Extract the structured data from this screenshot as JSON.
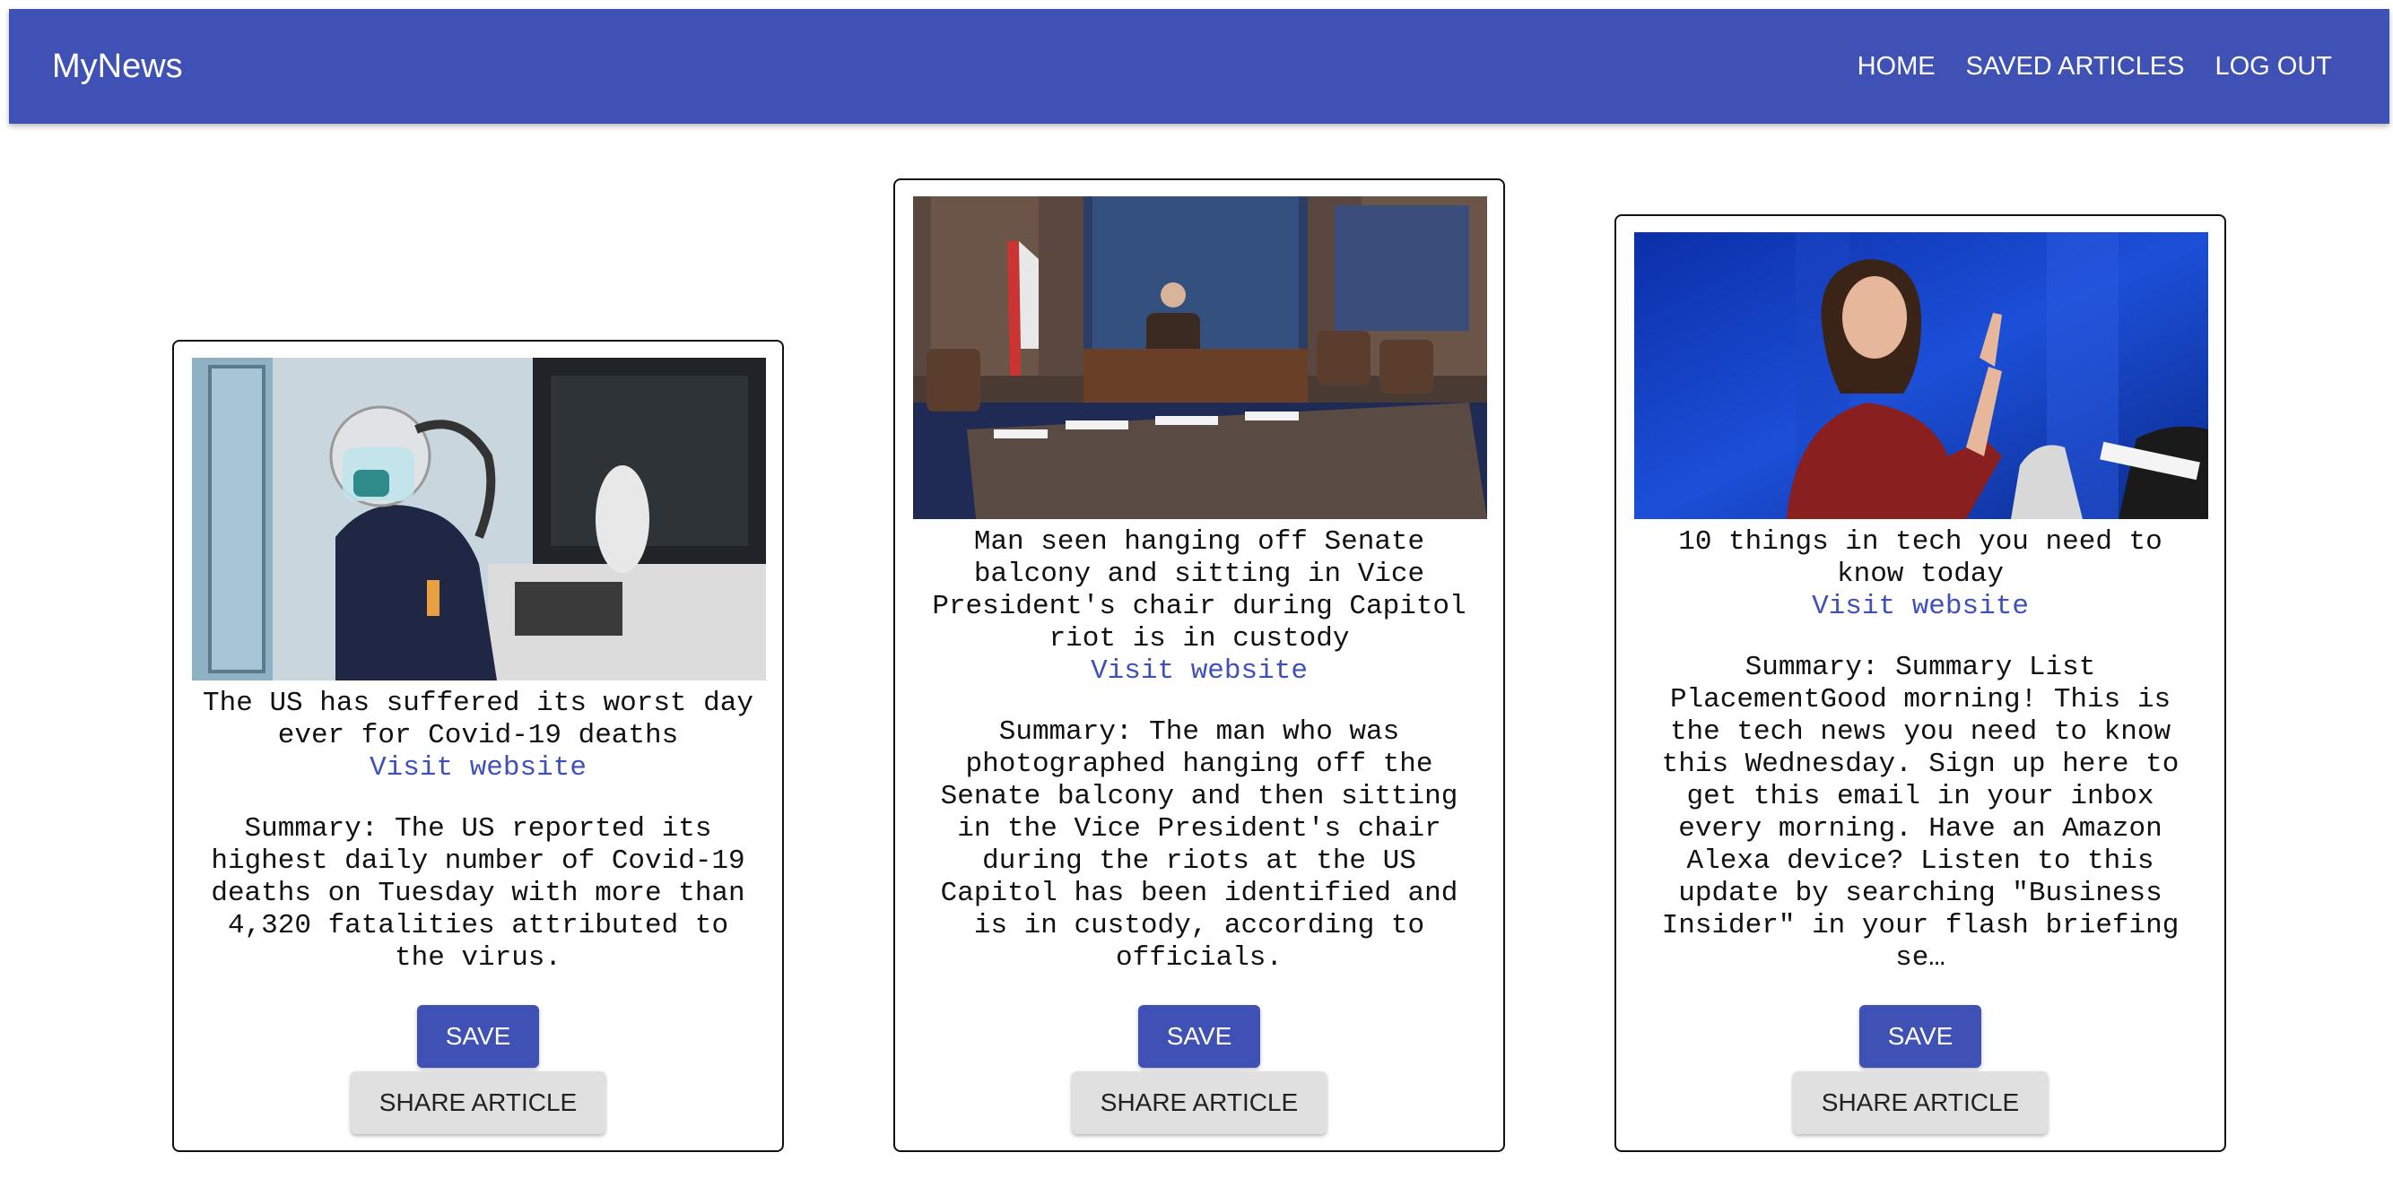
{
  "appbar": {
    "brand": "MyNews",
    "nav": [
      "HOME",
      "SAVED ARTICLES",
      "LOG OUT"
    ]
  },
  "articles": [
    {
      "headline": "The US has suffered its worst day ever for Covid-19 deaths",
      "visit_label": "Visit website",
      "summary": "Summary: The US reported its highest daily number of Covid-19 deaths on Tuesday with more than 4,320 fatalities attributed to the virus.",
      "save_label": "SAVE",
      "share_label": "SHARE ARTICLE",
      "image_icon": "hospital-worker-photo"
    },
    {
      "headline": "Man seen hanging off Senate balcony and sitting in Vice President's chair during Capitol riot is in custody",
      "visit_label": "Visit website",
      "summary": "Summary: The man who was photographed hanging off the Senate balcony and then sitting in the Vice President's chair during the riots at the US Capitol has been identified and is in custody, according to officials.",
      "save_label": "SAVE",
      "share_label": "SHARE ARTICLE",
      "image_icon": "senate-chamber-photo"
    },
    {
      "headline": "10 things in tech you need to know today",
      "visit_label": "Visit website",
      "summary": "Summary: Summary List PlacementGood morning! This is the tech news you need to know this Wednesday. Sign up here to get this email in your inbox every morning. Have an Amazon Alexa device? Listen to this update by searching \"Business Insider\" in your flash briefing se…",
      "save_label": "SAVE",
      "share_label": "SHARE ARTICLE",
      "image_icon": "speaker-on-stage-photo"
    }
  ],
  "colors": {
    "primary": "#3f51b5",
    "share_bg": "#e0e0e0"
  }
}
